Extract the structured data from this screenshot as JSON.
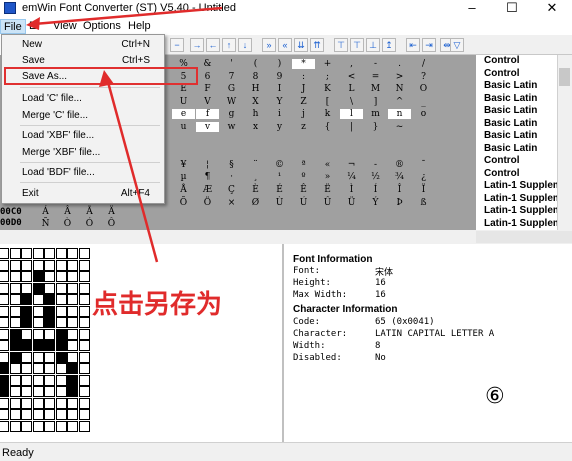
{
  "window": {
    "title": "emWin Font Converter (ST) V5.40 - Untitled",
    "minimize": "–",
    "maximize": "☐",
    "close": "✕"
  },
  "menubar": {
    "file": "File",
    "edit": "E",
    "view": "View",
    "options": "Options",
    "help": "Help"
  },
  "file_menu": {
    "new": "New",
    "new_shortcut": "Ctrl+N",
    "save": "Save",
    "save_shortcut": "Ctrl+S",
    "save_as": "Save As...",
    "load_c": "Load 'C' file...",
    "merge_c": "Merge 'C' file...",
    "load_xbf": "Load 'XBF' file...",
    "merge_xbf": "Merge 'XBF' file...",
    "load_bdf": "Load 'BDF' file...",
    "exit": "Exit",
    "exit_shortcut": "Alt+F4"
  },
  "toolbar_icons": [
    "minus-icon",
    "arrow-right-icon",
    "arrow-left-icon",
    "arrow-up-icon",
    "arrow-down-icon",
    "prev-icon",
    "rewind-icon",
    "down-icon",
    "up-icon",
    "align-top-icon",
    "align-top2-icon",
    "align-bottom-icon",
    "align-up-icon",
    "first-icon",
    "last-icon",
    "expand-icon",
    "filter-icon"
  ],
  "toolbar_glyphs": [
    "−",
    "→",
    "←",
    "↑",
    "↓",
    "»",
    "«",
    "⇊",
    "⇈",
    "⊤",
    "⊤",
    "⊥",
    "↥",
    "⇤",
    "⇥",
    "⇹",
    "▽"
  ],
  "char_grid": {
    "rows": [
      [
        "%",
        "&",
        "'",
        "(",
        ")",
        "*",
        "+",
        ",",
        "-",
        ".",
        "/"
      ],
      [
        "5",
        "6",
        "7",
        "8",
        "9",
        ":",
        ";",
        "<",
        "=",
        ">",
        "?"
      ],
      [
        "E",
        "F",
        "G",
        "H",
        "I",
        "J",
        "K",
        "L",
        "M",
        "N",
        "O"
      ],
      [
        "U",
        "V",
        "W",
        "X",
        "Y",
        "Z",
        "[",
        "\\",
        "]",
        "^",
        "_"
      ],
      [
        "e",
        "f",
        "g",
        "h",
        "i",
        "j",
        "k",
        "l",
        "m",
        "n",
        "o"
      ],
      [
        "u",
        "v",
        "w",
        "x",
        "y",
        "z",
        "{",
        "|",
        "}",
        "~",
        ""
      ],
      [
        "",
        "",
        "",
        "",
        "",
        "",
        "",
        "",
        "",
        "",
        ""
      ],
      [
        "",
        "",
        "",
        "",
        "",
        "",
        "",
        "",
        "",
        "",
        ""
      ],
      [
        "¥",
        "¦",
        "§",
        "¨",
        "©",
        "ª",
        "«",
        "¬",
        "-",
        "®",
        "¯"
      ],
      [
        "µ",
        "¶",
        "·",
        "¸",
        "¹",
        "º",
        "»",
        "¼",
        "½",
        "¾",
        "¿"
      ],
      [
        "Å",
        "Æ",
        "Ç",
        "È",
        "É",
        "Ê",
        "Ë",
        "Ì",
        "Í",
        "Î",
        "Ï"
      ],
      [
        "Õ",
        "Ö",
        "×",
        "Ø",
        "Ù",
        "Ú",
        "Û",
        "Ü",
        "Ý",
        "Þ",
        "ß"
      ]
    ],
    "left_glyphs_c": [
      "Á",
      "Â",
      "Ã",
      "Ä"
    ],
    "left_glyphs_d": [
      "Ñ",
      "Ò",
      "Ó",
      "Ô"
    ],
    "row_headers": [
      "00C0",
      "00D0"
    ]
  },
  "ranges": [
    "Control",
    "Control",
    "Basic Latin",
    "Basic Latin",
    "Basic Latin",
    "Basic Latin",
    "Basic Latin",
    "Basic Latin",
    "Control",
    "Control",
    "Latin-1 Supplem",
    "Latin-1 Supplem",
    "Latin-1 Supplem",
    "Latin-1 Supplem"
  ],
  "font_info": {
    "heading": "Font Information",
    "font_label": "Font:",
    "font_value": "宋体",
    "height_label": "Height:",
    "height_value": "16",
    "maxw_label": "Max Width:",
    "maxw_value": "16"
  },
  "char_info": {
    "heading": "Character Information",
    "code_label": "Code:",
    "code_value": "65 (0x0041)",
    "char_label": "Character:",
    "char_value": "LATIN CAPITAL LETTER A",
    "width_label": "Width:",
    "width_value": "8",
    "disabled_label": "Disabled:",
    "disabled_value": "No"
  },
  "glyph_bitmap": [
    "........",
    "........",
    "...#....",
    "...#....",
    "..#.#...",
    "..#.#...",
    "..#.#...",
    ".#...#..",
    ".#####..",
    ".#...#..",
    "#.....#.",
    "#.....#.",
    "#.....#.",
    "........",
    "........",
    "........"
  ],
  "circled_number": "⑥",
  "annotation": "点击另存为",
  "status": "Ready",
  "colors": {
    "accent": "#e02b2b",
    "grid_bg": "#a0a0a0"
  }
}
